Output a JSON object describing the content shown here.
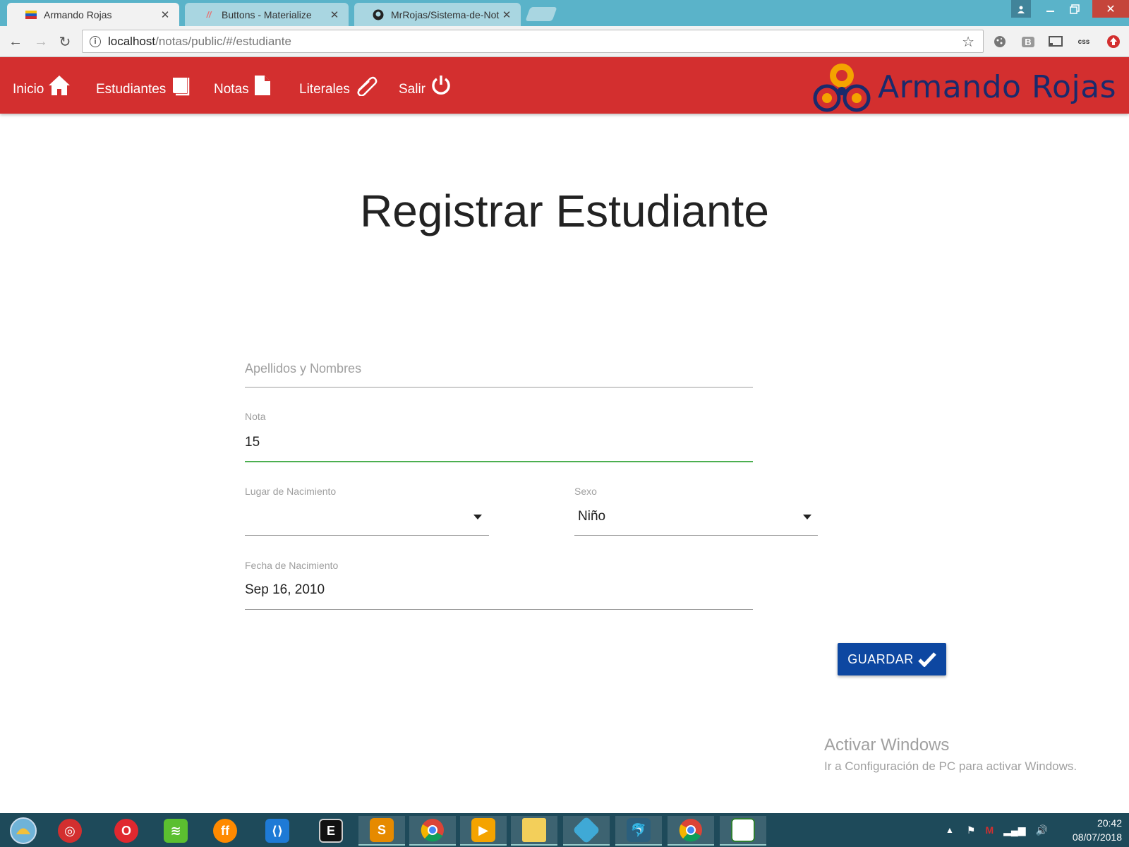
{
  "browser": {
    "tabs": [
      {
        "label": "Armando Rojas",
        "icon": "venezuela-flag-icon",
        "active": true
      },
      {
        "label": "Buttons - Materialize",
        "icon": "materialize-icon",
        "active": false
      },
      {
        "label": "MrRojas/Sistema-de-Not",
        "icon": "github-icon",
        "active": false
      }
    ],
    "url": {
      "host": "localhost",
      "path": "/notas/public/#/estudiante"
    },
    "extensions": [
      "cookie-icon",
      "bootstrap-icon",
      "cast-icon",
      "css-icon",
      "update-icon"
    ]
  },
  "navbar": {
    "color": "#d32f2f",
    "items": [
      {
        "label": "Inicio",
        "icon": "home-icon"
      },
      {
        "label": "Estudiantes",
        "icon": "book-icon"
      },
      {
        "label": "Notas",
        "icon": "file-icon"
      },
      {
        "label": "Literales",
        "icon": "paperclip-icon"
      },
      {
        "label": "Salir",
        "icon": "power-icon"
      }
    ],
    "brand": "Armando Rojas"
  },
  "page": {
    "title": "Registrar Estudiante"
  },
  "form": {
    "nombres": {
      "placeholder": "Apellidos y Nombres",
      "value": ""
    },
    "nota": {
      "label": "Nota",
      "value": "15"
    },
    "lugar": {
      "label": "Lugar de Nacimiento",
      "value": ""
    },
    "sexo": {
      "label": "Sexo",
      "value": "Niño"
    },
    "fecha": {
      "label": "Fecha de Nacimiento",
      "value": "Sep 16, 2010"
    },
    "save_label": "GUARDAR",
    "save_color": "#0d47a1",
    "active_color": "#4caf50"
  },
  "watermark": {
    "line1": "Activar Windows",
    "line2": "Ir a Configuración de PC para activar Windows."
  },
  "taskbar": {
    "apps": [
      "start-icon",
      "vlc-icon",
      "opera-icon",
      "wifi-icon",
      "firefox-icon",
      "vscode-icon",
      "terminal-icon",
      "sublime-icon",
      "chrome-icon",
      "media-icon",
      "folder-icon",
      "git-icon",
      "mysql-icon",
      "chrome-icon",
      "window-icon"
    ],
    "time": "20:42",
    "date": "08/07/2018"
  }
}
